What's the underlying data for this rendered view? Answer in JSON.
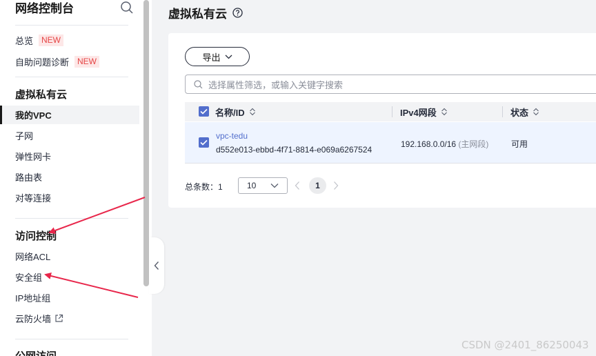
{
  "sidebar": {
    "title": "网络控制台",
    "overview": "总览",
    "overview_badge": "NEW",
    "diagnose": "自助问题诊断",
    "diagnose_badge": "NEW",
    "group_vpc": "虚拟私有云",
    "my_vpc": "我的VPC",
    "subnet": "子网",
    "eni": "弹性网卡",
    "route_table": "路由表",
    "peering": "对等连接",
    "group_access": "访问控制",
    "acl": "网络ACL",
    "security_group": "安全组",
    "ip_group": "IP地址组",
    "firewall": "云防火墙",
    "group_public": "公网访问"
  },
  "main": {
    "title": "虚拟私有云",
    "export_label": "导出",
    "search_placeholder": "选择属性筛选，或输入关键字搜索",
    "columns": [
      "名称/ID",
      "IPv4网段",
      "状态"
    ],
    "rows": [
      {
        "name": "vpc-tedu",
        "id": "d552e013-ebbd-4f71-8814-e069a6267524",
        "cidr": "192.168.0.0/16",
        "cidr_note": "(主网段)",
        "status": "可用"
      }
    ],
    "pagination": {
      "total_label": "总条数：",
      "total": "1",
      "page_size": "10",
      "current_page": "1"
    }
  },
  "watermark": "CSDN @2401_86250043",
  "colors": {
    "accent": "#526ecc",
    "badge_bg": "#fde7e7",
    "badge_text": "#e54545",
    "annotation_arrow": "#e8274b"
  }
}
